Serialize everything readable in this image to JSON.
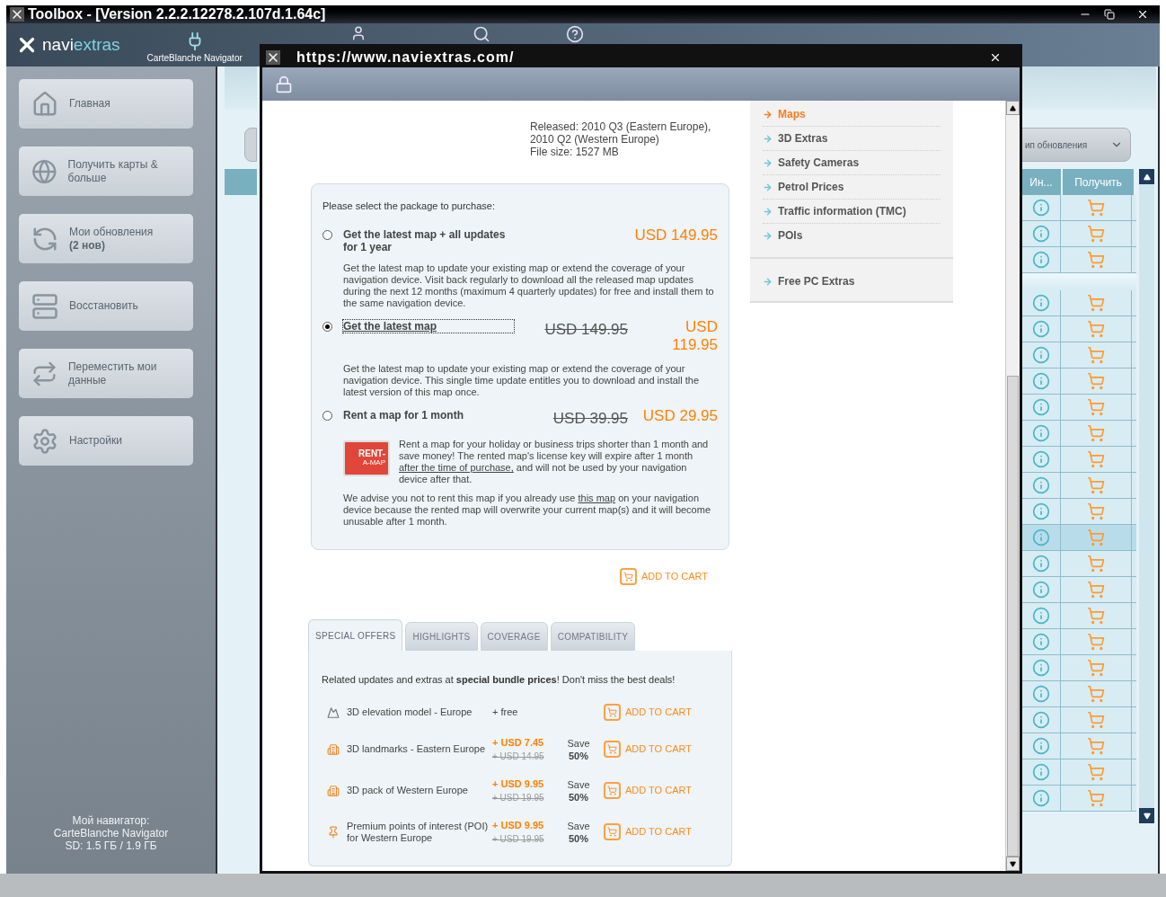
{
  "window": {
    "title": "Toolbox - [Version 2.2.2.12278.2.107d.1.64c]"
  },
  "header": {
    "logo": {
      "prefix": "navi",
      "suffix": "extras"
    },
    "device_label": "CarteBlanche Navigator"
  },
  "sidebar": {
    "items": [
      {
        "kind": "home",
        "label": "Главная"
      },
      {
        "kind": "globe",
        "label": "Получить карты & больше"
      },
      {
        "kind": "sync",
        "label": "Мои обновления",
        "badge": "(2 нов)"
      },
      {
        "kind": "restore",
        "label": "Восстановить"
      },
      {
        "kind": "transfer",
        "label": "Переместить мои данные"
      },
      {
        "kind": "settings",
        "label": "Настройки"
      }
    ],
    "footer": [
      "Мой навигатор:",
      "CarteBlanche Navigator",
      "SD: 1.5 ГБ / 1.9 ГБ"
    ]
  },
  "updates_table": {
    "filter": "ип обновления",
    "columns": [
      "Ин...",
      "Получить"
    ],
    "groups": [
      {
        "rows": [
          {
            "selected": false
          },
          {
            "selected": false
          },
          {
            "selected": false
          }
        ]
      },
      {
        "rows": [
          {
            "selected": false
          },
          {
            "selected": false
          },
          {
            "selected": false
          },
          {
            "selected": false
          },
          {
            "selected": false
          },
          {
            "selected": false
          },
          {
            "selected": false
          },
          {
            "selected": false
          },
          {
            "selected": false
          },
          {
            "selected": true
          },
          {
            "selected": false
          },
          {
            "selected": false
          },
          {
            "selected": false
          },
          {
            "selected": false
          },
          {
            "selected": false
          },
          {
            "selected": false
          },
          {
            "selected": false
          },
          {
            "selected": false
          },
          {
            "selected": false
          },
          {
            "selected": false
          }
        ]
      }
    ]
  },
  "browser": {
    "url": "https://www.naviextras.com/",
    "release_info": [
      "Released: 2010 Q3 (Eastern Europe),",
      "2010 Q2 (Western Europe)",
      "File size: 1527 MB"
    ],
    "package_box": {
      "prompt": "Please select the package to purchase:",
      "options": [
        {
          "selected": false,
          "title": "Get the latest map + all updates for 1 year",
          "price": "USD 149.95",
          "description": [
            {
              "text": "Get the latest map to update your existing map or extend the coverage of your navigation device. Visit back regularly to download all the released map updates during the next 12 months (maximum 4 quarterly updates) for free and install them to the same navigation device.",
              "link": false
            }
          ]
        },
        {
          "selected": true,
          "title": "Get the latest map",
          "old_price": "USD 149.95",
          "price": "USD 119.95",
          "description": [
            {
              "text": "Get the latest map to update your existing map or extend the coverage of your navigation device. This single time update entitles you to download and install the latest version of this map once.",
              "link": false
            }
          ]
        },
        {
          "selected": false,
          "title": "Rent a map for 1 month",
          "old_price": "USD 39.95",
          "price": "USD 29.95",
          "badge": [
            "RENT-",
            "A-MAP"
          ],
          "description": [
            {
              "text": "Rent a map for your holiday or business trips shorter than 1 month and save money! The rented map's license key will expire after 1 month ",
              "link": false
            },
            {
              "text": "after the time of purchase,",
              "link": true
            },
            {
              "text": " and will not be used by your navigation device after that.",
              "link": false
            }
          ],
          "note": [
            {
              "text": "We advise you not to rent this map if you already use ",
              "link": false
            },
            {
              "text": "this map",
              "link": true
            },
            {
              "text": " on your navigation device because the rented map will overwrite your current map(s) and it will become unusable after 1 month.",
              "link": false
            }
          ]
        }
      ]
    },
    "add_to_cart": "ADD TO CART",
    "category_menu": [
      [
        {
          "label": "Maps",
          "selected": true
        },
        {
          "label": "3D Extras",
          "selected": false
        },
        {
          "label": "Safety Cameras",
          "selected": false
        },
        {
          "label": "Petrol Prices",
          "selected": false
        },
        {
          "label": "Traffic information (TMC)",
          "selected": false
        },
        {
          "label": "POIs",
          "selected": false
        }
      ],
      [
        {
          "label": "Free PC Extras",
          "selected": false
        }
      ]
    ],
    "tabs": [
      {
        "label": "SPECIAL OFFERS",
        "selected": true
      },
      {
        "label": "HIGHLIGHTS",
        "selected": false
      },
      {
        "label": "COVERAGE",
        "selected": false
      },
      {
        "label": "COMPATIBILITY",
        "selected": false
      }
    ],
    "offers": {
      "intro": "Related updates and extras at **special bundle prices**! Don't miss the best deals!",
      "items": [
        {
          "kind": "elevation",
          "name": "3D elevation model - Europe",
          "price": "+ free",
          "button": "ADD TO CART"
        },
        {
          "kind": "building",
          "name": "3D landmarks - Eastern Europe",
          "price": "+ USD 7.45",
          "old_price": "+ USD 14.95",
          "save": [
            "Save",
            "50%"
          ],
          "button": "ADD TO CART"
        },
        {
          "kind": "building",
          "name": "3D pack of Western Europe",
          "price": "+ USD 9.95",
          "old_price": "+ USD 19.95",
          "save": [
            "Save",
            "50%"
          ],
          "button": "ADD TO CART"
        },
        {
          "kind": "pin",
          "name": "Premium points of interest (POI) for Western Europe",
          "price": "+ USD 9.95",
          "old_price": "+ USD 19.95",
          "save": [
            "Save",
            "50%"
          ],
          "button": "ADD TO CART"
        }
      ]
    }
  }
}
